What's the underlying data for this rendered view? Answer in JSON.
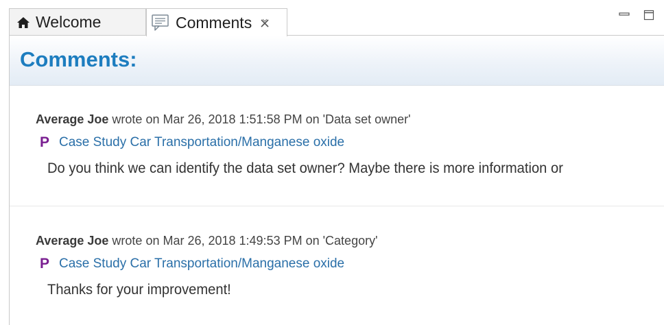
{
  "tabs": [
    {
      "label": "Welcome",
      "icon": "home-icon"
    },
    {
      "label": "Comments",
      "icon": "comment-icon",
      "active": true,
      "closable": true
    }
  ],
  "view_controls": {
    "minimize_icon": "minimize-icon",
    "maximize_icon": "maximize-icon"
  },
  "page": {
    "title": "Comments:"
  },
  "comments": [
    {
      "author": "Average Joe",
      "meta": "wrote on Mar 26, 2018 1:51:58 PM on 'Data set owner'",
      "item_type": "P",
      "link": "Case Study Car Transportation/Manganese oxide",
      "body": "Do you think we can identify the data set owner? Maybe there is more information or"
    },
    {
      "author": "Average Joe",
      "meta": "wrote on Mar 26, 2018 1:49:53 PM on 'Category'",
      "item_type": "P",
      "link": "Case Study Car Transportation/Manganese oxide",
      "body": "Thanks for your improvement!"
    }
  ],
  "colors": {
    "title": "#1d7dbf",
    "link": "#2a6fa8",
    "process_icon": "#7a1f91",
    "header_band": "#e3ecf5"
  }
}
